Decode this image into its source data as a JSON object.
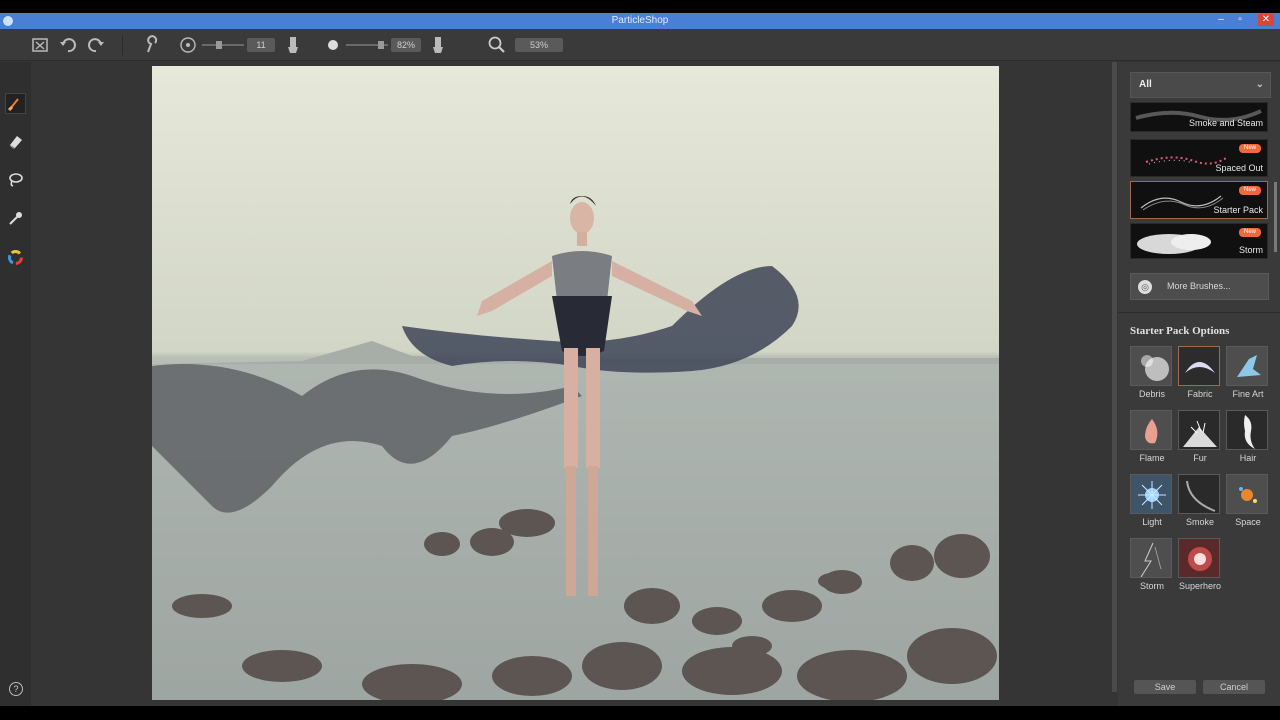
{
  "window": {
    "title": "ParticleShop"
  },
  "toolbar": {
    "brush_size_value": "11",
    "opacity_value": "82%",
    "zoom_value": "53%"
  },
  "left_tools": [
    {
      "name": "brush-tool",
      "icon": "paintbrush-icon",
      "active": true
    },
    {
      "name": "eraser-tool",
      "icon": "eraser-icon",
      "active": false
    },
    {
      "name": "lasso-tool",
      "icon": "lasso-icon",
      "active": false
    },
    {
      "name": "eyedropper-tool",
      "icon": "eyedropper-icon",
      "active": false
    },
    {
      "name": "color-tool",
      "icon": "color-wheel-icon",
      "active": false
    }
  ],
  "right_panel": {
    "filter": "All",
    "brushes": [
      {
        "label": "Smoke and Steam",
        "new": false
      },
      {
        "label": "Spaced Out",
        "new": true,
        "new_label": "New"
      },
      {
        "label": "Starter Pack",
        "new": true,
        "new_label": "New",
        "selected": true
      },
      {
        "label": "Storm",
        "new": true,
        "new_label": "New"
      }
    ],
    "more_brushes": "More Brushes...",
    "options_title": "Starter Pack Options",
    "options": [
      {
        "label": "Debris"
      },
      {
        "label": "Fabric",
        "selected": true
      },
      {
        "label": "Fine Art"
      },
      {
        "label": "Flame"
      },
      {
        "label": "Fur"
      },
      {
        "label": "Hair"
      },
      {
        "label": "Light"
      },
      {
        "label": "Smoke"
      },
      {
        "label": "Space"
      },
      {
        "label": "Storm"
      },
      {
        "label": "Superhero"
      }
    ],
    "save": "Save",
    "cancel": "Cancel"
  },
  "colors": {
    "accent": "#ef6a3a",
    "titlebar": "#4b7fd6",
    "panel": "#3a3a3a"
  }
}
